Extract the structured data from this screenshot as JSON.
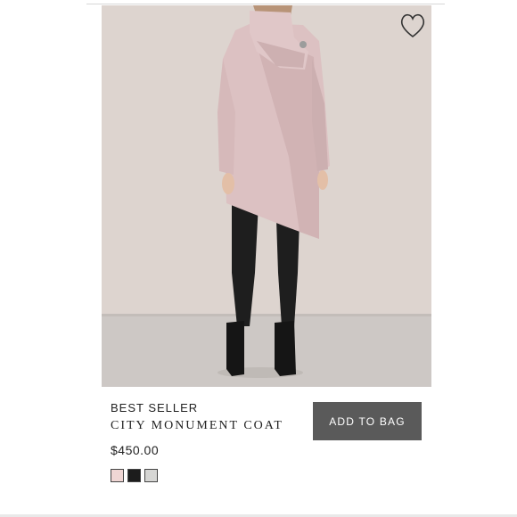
{
  "product": {
    "badge": "BEST SELLER",
    "name": "CITY MONUMENT COAT",
    "price": "$450.00",
    "add_to_bag_label": "ADD TO BAG",
    "image_alt": "Model wearing pink asymmetric wrap coat",
    "wishlist_icon": "heart-outline-icon",
    "swatches": [
      {
        "name": "pink",
        "color": "#f0d6d4"
      },
      {
        "name": "black",
        "color": "#1c1c1c"
      },
      {
        "name": "light-grey",
        "color": "#d6d6d4"
      }
    ]
  },
  "colors": {
    "button_bg": "#5a5a5a",
    "image_wall": "#dcd3ce",
    "image_floor": "#cbc7c4",
    "coat": "#dcc0c0"
  }
}
